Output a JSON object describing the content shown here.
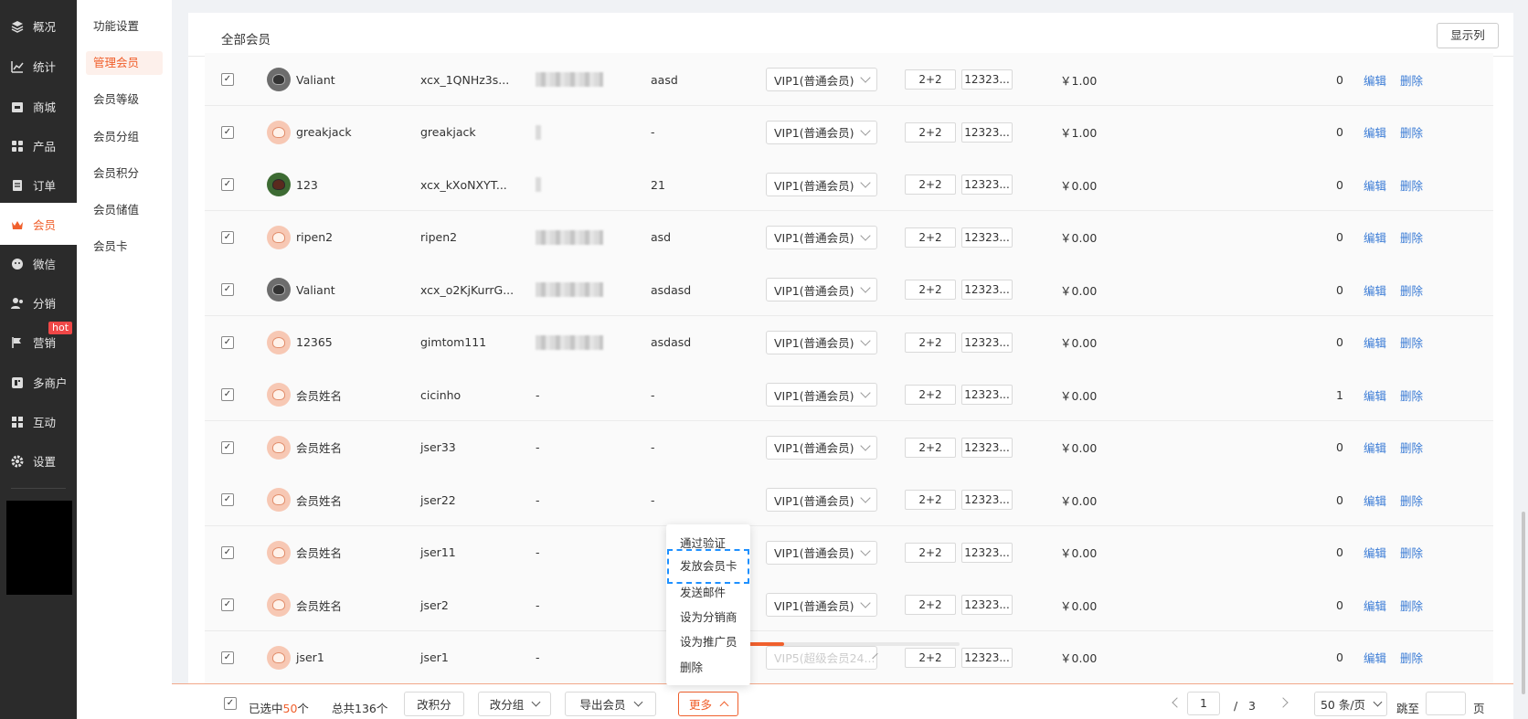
{
  "sidebar": {
    "items": [
      {
        "label": "概况",
        "icon": "layers-icon"
      },
      {
        "label": "统计",
        "icon": "chart-icon"
      },
      {
        "label": "商城",
        "icon": "store-icon"
      },
      {
        "label": "产品",
        "icon": "grid-icon"
      },
      {
        "label": "订单",
        "icon": "order-icon"
      },
      {
        "label": "会员",
        "icon": "crown-icon"
      },
      {
        "label": "微信",
        "icon": "wechat-icon"
      },
      {
        "label": "分销",
        "icon": "users-icon"
      },
      {
        "label": "营销",
        "icon": "flag-icon"
      },
      {
        "label": "多商户",
        "icon": "shop-icon"
      },
      {
        "label": "互动",
        "icon": "interact-icon"
      },
      {
        "label": "设置",
        "icon": "gear-icon"
      }
    ],
    "hot_badge": "hot"
  },
  "sub_sidebar": {
    "items": [
      "功能设置",
      "管理会员",
      "会员等级",
      "会员分组",
      "会员积分",
      "会员储值",
      "会员卡"
    ]
  },
  "header": {
    "tab": "全部会员",
    "show_columns": "显示列"
  },
  "table": {
    "rows": [
      {
        "name": "Valiant",
        "account": "xcx_1QNHz3s...",
        "phone_blur": true,
        "remark": "aasd",
        "level": "VIP1(普通会员)",
        "tag1": "2+2",
        "tag2": "12323...",
        "balance": "￥1.00",
        "points": "0",
        "avatar": "dark"
      },
      {
        "name": "greakjack",
        "account": "greakjack",
        "phone_blur": "small",
        "remark": "-",
        "level": "VIP1(普通会员)",
        "tag1": "2+2",
        "tag2": "12323...",
        "balance": "￥1.00",
        "points": "0",
        "avatar": "default"
      },
      {
        "name": "123",
        "account": "xcx_kXoNXYT...",
        "phone_blur": "small",
        "remark": "21",
        "level": "VIP1(普通会员)",
        "tag1": "2+2",
        "tag2": "12323...",
        "balance": "￥0.00",
        "points": "0",
        "avatar": "green"
      },
      {
        "name": "ripen2",
        "account": "ripen2",
        "phone_blur": true,
        "remark": "asd",
        "level": "VIP1(普通会员)",
        "tag1": "2+2",
        "tag2": "12323...",
        "balance": "￥0.00",
        "points": "0",
        "avatar": "default"
      },
      {
        "name": "Valiant",
        "account": "xcx_o2KjKurrG...",
        "phone_blur": true,
        "remark": "asdasd",
        "level": "VIP1(普通会员)",
        "tag1": "2+2",
        "tag2": "12323...",
        "balance": "￥0.00",
        "points": "0",
        "avatar": "dark"
      },
      {
        "name": "12365",
        "account": "gimtom111",
        "phone_blur": true,
        "remark": "asdasd",
        "level": "VIP1(普通会员)",
        "tag1": "2+2",
        "tag2": "12323...",
        "balance": "￥0.00",
        "points": "0",
        "avatar": "default"
      },
      {
        "name": "会员姓名",
        "account": "cicinho",
        "phone": "-",
        "remark": "-",
        "level": "VIP1(普通会员)",
        "tag1": "2+2",
        "tag2": "12323...",
        "balance": "￥0.00",
        "points": "1",
        "avatar": "default"
      },
      {
        "name": "会员姓名",
        "account": "jser33",
        "phone": "-",
        "remark": "-",
        "level": "VIP1(普通会员)",
        "tag1": "2+2",
        "tag2": "12323...",
        "balance": "￥0.00",
        "points": "0",
        "avatar": "default"
      },
      {
        "name": "会员姓名",
        "account": "jser22",
        "phone": "-",
        "remark": "-",
        "level": "VIP1(普通会员)",
        "tag1": "2+2",
        "tag2": "12323...",
        "balance": "￥0.00",
        "points": "0",
        "avatar": "default"
      },
      {
        "name": "会员姓名",
        "account": "jser11",
        "phone": "-",
        "remark": "",
        "level": "VIP1(普通会员)",
        "tag1": "2+2",
        "tag2": "12323...",
        "balance": "￥0.00",
        "points": "0",
        "avatar": "default"
      },
      {
        "name": "会员姓名",
        "account": "jser2",
        "phone": "-",
        "remark": "",
        "level": "VIP1(普通会员)",
        "tag1": "2+2",
        "tag2": "12323...",
        "balance": "￥0.00",
        "points": "0",
        "avatar": "default"
      },
      {
        "name": "jser1",
        "account": "jser1",
        "phone": "-",
        "remark": "",
        "level": "VIP5(超级会员24...",
        "tag1": "2+2",
        "tag2": "12323...",
        "balance": "￥0.00",
        "points": "0",
        "avatar": "default"
      }
    ],
    "edit_label": "编辑",
    "delete_label": "删除"
  },
  "more_menu": {
    "items": [
      "通过验证",
      "发放会员卡",
      "发送邮件",
      "设为分销商",
      "设为推广员",
      "删除"
    ]
  },
  "footer": {
    "selected_prefix": "已选中",
    "selected_count": "50",
    "selected_suffix": "个",
    "total": "总共136个",
    "btn_points": "改积分",
    "btn_group": "改分组",
    "btn_export": "导出会员",
    "btn_more": "更多",
    "page_current": "1",
    "page_sep": "/",
    "page_total": "3",
    "page_size": "50 条/页",
    "jump_label": "跳至",
    "jump_value": "",
    "page_suffix": "页"
  },
  "colors": {
    "accent": "#f0602d",
    "link": "#3a7bd5",
    "sidebar_bg": "#2b2b2b"
  }
}
